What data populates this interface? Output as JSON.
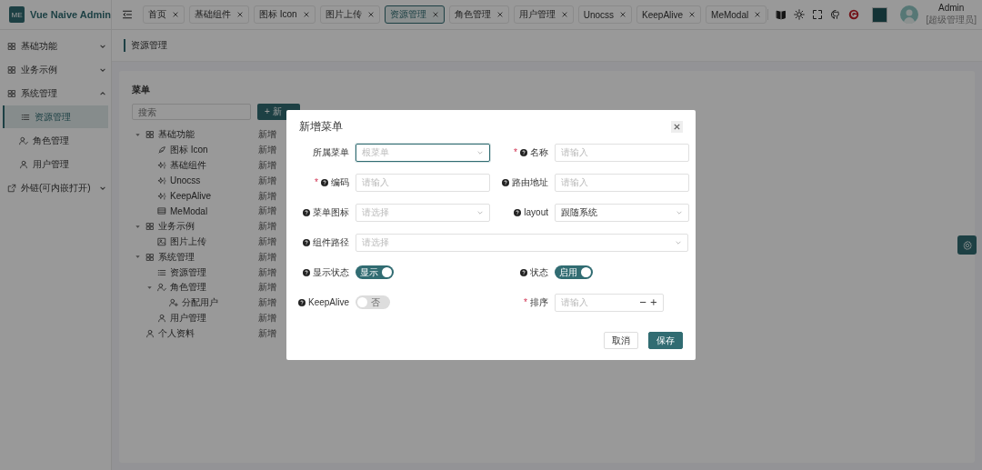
{
  "app": {
    "logo": "ME",
    "title": "Vue Naive Admin"
  },
  "tabs": [
    {
      "label": "首页",
      "selected": false
    },
    {
      "label": "基础组件",
      "selected": false
    },
    {
      "label": "图标 Icon",
      "selected": false
    },
    {
      "label": "图片上传",
      "selected": false
    },
    {
      "label": "资源管理",
      "selected": true
    },
    {
      "label": "角色管理",
      "selected": false
    },
    {
      "label": "用户管理",
      "selected": false
    },
    {
      "label": "Unocss",
      "selected": false
    },
    {
      "label": "KeepAlive",
      "selected": false
    },
    {
      "label": "MeModal",
      "selected": false
    }
  ],
  "user": {
    "name": "Admin",
    "role": "[超级管理员]"
  },
  "sidebar": {
    "items": [
      {
        "label": "基础功能",
        "kind": "grid",
        "expanded": false
      },
      {
        "label": "业务示例",
        "kind": "grid",
        "expanded": false
      },
      {
        "label": "系统管理",
        "kind": "grid",
        "expanded": true,
        "children": [
          {
            "label": "资源管理",
            "kind": "list",
            "selected": true
          },
          {
            "label": "角色管理",
            "kind": "user-check",
            "selected": false
          },
          {
            "label": "用户管理",
            "kind": "user",
            "selected": false
          }
        ]
      },
      {
        "label": "外链(可内嵌打开)",
        "kind": "external",
        "expanded": false
      }
    ]
  },
  "breadcrumb": "资源管理",
  "menu_panel": {
    "title": "菜单",
    "search": {
      "placeholder": "搜索"
    },
    "add_button": "+ 新",
    "tree": [
      {
        "label": "基础功能",
        "kind": "grid",
        "action": "新增",
        "expanded": true,
        "children": [
          {
            "label": "图标 Icon",
            "kind": "feather",
            "action": "新增"
          },
          {
            "label": "基础组件",
            "kind": "sparkle",
            "action": "新增"
          },
          {
            "label": "Unocss",
            "kind": "sparkle",
            "action": "新增"
          },
          {
            "label": "KeepAlive",
            "kind": "sparkle",
            "action": "新增"
          },
          {
            "label": "MeModal",
            "kind": "window",
            "action": "新增"
          }
        ]
      },
      {
        "label": "业务示例",
        "kind": "grid",
        "action": "新增",
        "expanded": true,
        "children": [
          {
            "label": "图片上传",
            "kind": "image",
            "action": "新增"
          }
        ]
      },
      {
        "label": "系统管理",
        "kind": "grid",
        "action": "新增",
        "expanded": true,
        "children": [
          {
            "label": "资源管理",
            "kind": "list",
            "action": "新增"
          },
          {
            "label": "角色管理",
            "kind": "user-check",
            "action": "新增",
            "expanded": true,
            "children": [
              {
                "label": "分配用户",
                "kind": "user-plus",
                "action": "新增"
              }
            ]
          },
          {
            "label": "用户管理",
            "kind": "user",
            "action": "新增"
          }
        ]
      },
      {
        "label": "个人资料",
        "kind": "user",
        "action": "新增"
      }
    ]
  },
  "dialog": {
    "title": "新增菜单",
    "fields": [
      {
        "kind": "select",
        "label": "所属菜单",
        "hint": false,
        "placeholder": "根菜单",
        "focused": true
      },
      {
        "kind": "input",
        "label": "名称",
        "mark": "*",
        "hint": true,
        "placeholder": "请输入",
        "focused": false
      },
      {
        "kind": "input",
        "label": "编码",
        "mark": "*",
        "hint": true,
        "placeholder": "请输入",
        "focused": false
      },
      {
        "kind": "input",
        "label": "路由地址",
        "hint": true,
        "placeholder": "请输入",
        "focused": false
      },
      {
        "kind": "select",
        "label": "菜单图标",
        "hint": true,
        "placeholder": "请选择",
        "focused": false
      },
      {
        "kind": "select",
        "label": "layout",
        "hint": true,
        "value": "跟随系统",
        "focused": false
      },
      {
        "kind": "select-wide",
        "label": "组件路径",
        "hint": true,
        "placeholder": "请选择",
        "focused": false
      },
      {
        "kind": "switch",
        "label": "显示状态",
        "hint": true,
        "on": true,
        "text": "显示"
      },
      {
        "kind": "switch",
        "label": "状态",
        "hint": true,
        "on": true,
        "text": "启用"
      },
      {
        "kind": "switch",
        "label": "KeepAlive",
        "hint": true,
        "on": false,
        "text": "否"
      },
      {
        "kind": "number",
        "label": "排序",
        "mark": "*",
        "hint": false,
        "placeholder": "请输入",
        "focused": false
      }
    ],
    "buttons": [
      {
        "label": "取消",
        "kind": "secondary"
      },
      {
        "label": "保存",
        "kind": "primary"
      }
    ]
  }
}
